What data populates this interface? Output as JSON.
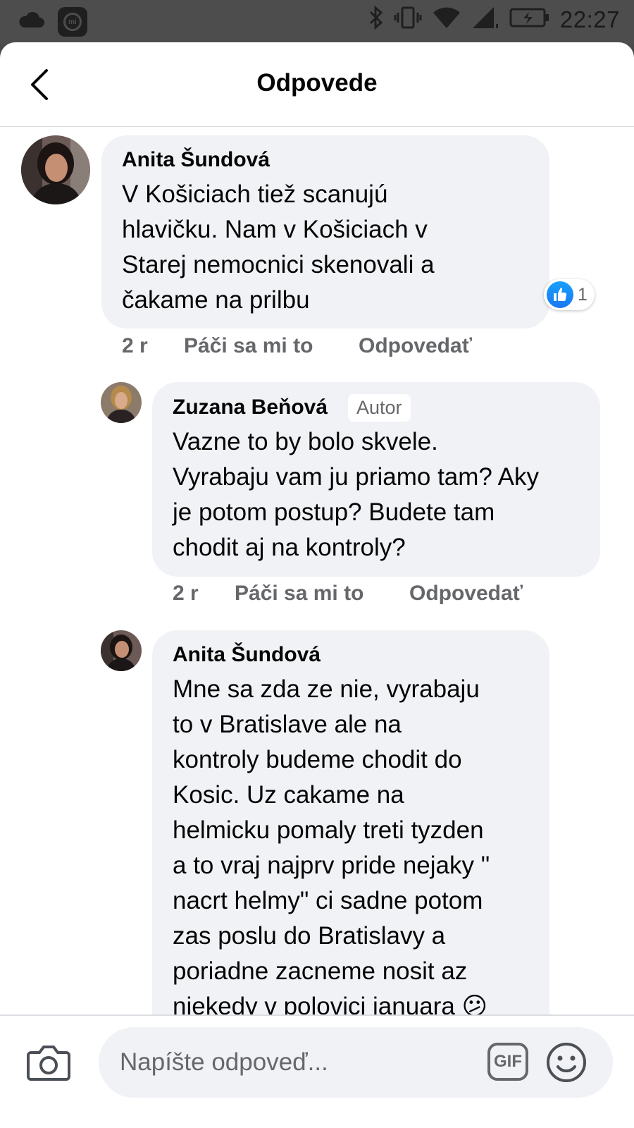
{
  "status_bar": {
    "time": "22:27",
    "icons": [
      "cloud-icon",
      "mi-app-icon",
      "bluetooth-icon",
      "vibrate-icon",
      "wifi-icon",
      "signal-icon",
      "battery-charging-icon"
    ]
  },
  "header": {
    "title": "Odpovede",
    "back_icon": "chevron-left-icon"
  },
  "comments": [
    {
      "author": "Anita Šundová",
      "text_lines": [
        "V Košiciach tiež scanujú",
        "hlavičku. Nam v Košiciach v",
        "Starej nemocnici skenovali a",
        "čakame na prilbu"
      ],
      "age": "2 r",
      "like_label": "Páči sa mi to",
      "reply_label": "Odpovedať",
      "reaction": {
        "icon": "like-icon",
        "count": "1"
      }
    },
    {
      "author": "Zuzana Beňová",
      "badge": "Autor",
      "text_lines": [
        "Vazne to by bolo skvele.",
        "Vyrabaju vam ju priamo tam? Aky",
        "je potom postup? Budete tam",
        "chodit aj na kontroly?"
      ],
      "age": "2 r",
      "like_label": "Páči sa mi to",
      "reply_label": "Odpovedať"
    },
    {
      "author": "Anita Šundová",
      "text_lines": [
        "Mne sa zda ze nie, vyrabaju",
        "to v Bratislave ale na",
        "kontroly budeme chodit do",
        "Kosic. Uz cakame na",
        "helmicku pomaly treti tyzden",
        "a to vraj najprv pride nejaky \"",
        "nacrt helmy\" ci sadne potom",
        "zas poslu do Bratislavy a",
        "poriadne zacneme nosit az",
        "niekedy v polovici januara 😕"
      ]
    }
  ],
  "composer": {
    "placeholder": "Napíšte odpoveď...",
    "gif_label": "GIF",
    "camera_icon": "camera-icon",
    "emoji_icon": "smiley-icon"
  },
  "colors": {
    "bubble": "#f0f2f5",
    "secondary_text": "#65676b",
    "like_blue": "#1877f2"
  }
}
